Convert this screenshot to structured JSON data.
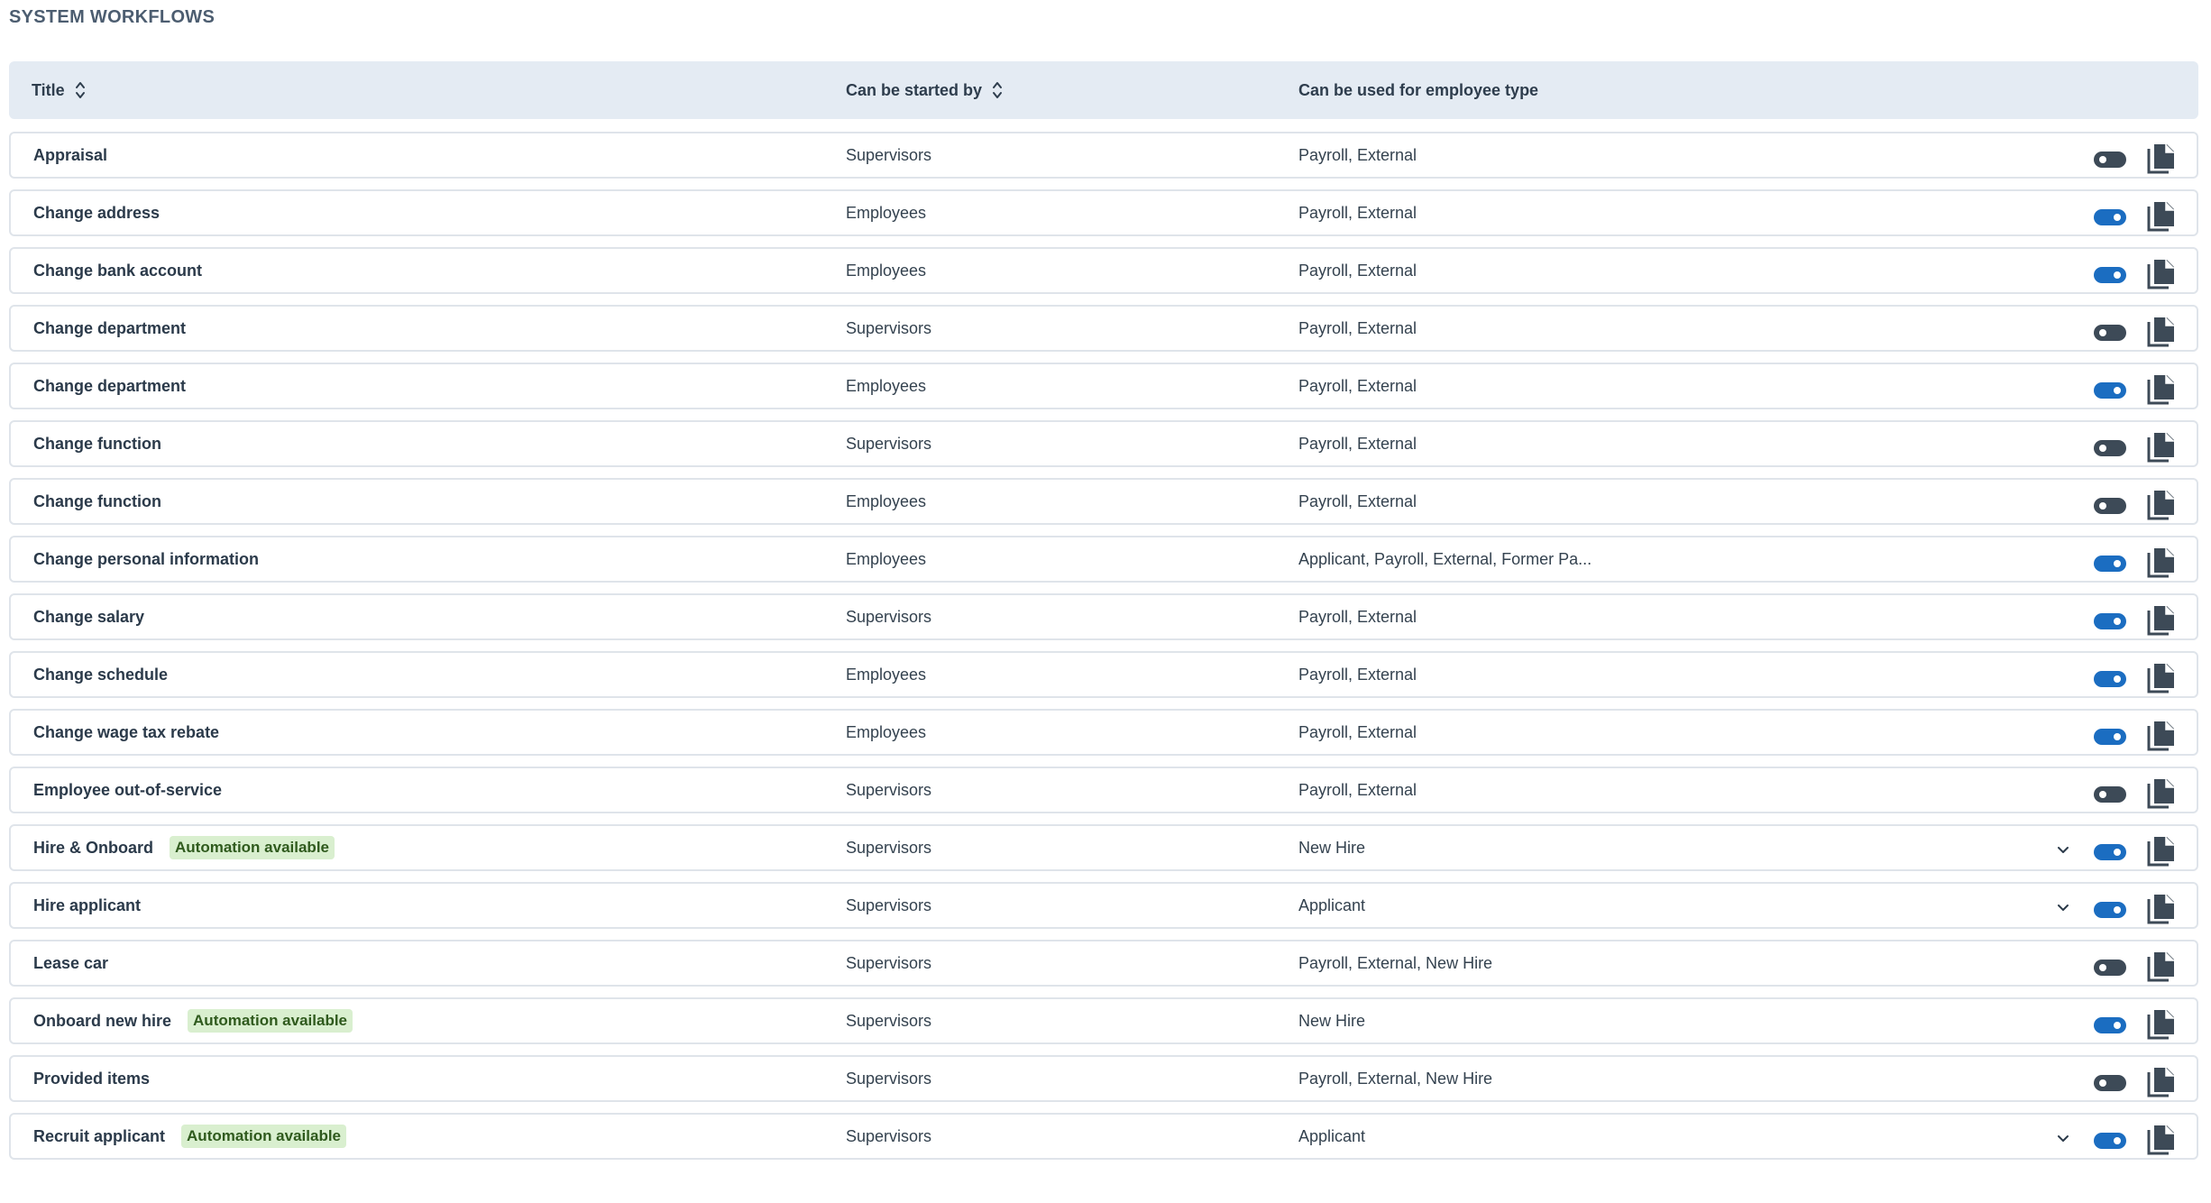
{
  "section": {
    "title": "SYSTEM WORKFLOWS"
  },
  "columns": {
    "title": "Title",
    "started_by": "Can be started by",
    "employee_type": "Can be used for employee type"
  },
  "badge_label": "Automation available",
  "colors": {
    "toggle_on": "#1b6dc1",
    "toggle_off": "#3d4a57",
    "badge_bg": "#d9efcf",
    "header_bg": "#e4ebf3"
  },
  "icons": {
    "sort": "sort-icon",
    "toggle": "toggle-icon",
    "copy": "copy-icon",
    "expand": "chevron-down-icon"
  },
  "rows": [
    {
      "title": "Appraisal",
      "started_by": "Supervisors",
      "employee_type": "Payroll, External",
      "enabled": false,
      "automation": false,
      "expandable": false
    },
    {
      "title": "Change address",
      "started_by": "Employees",
      "employee_type": "Payroll, External",
      "enabled": true,
      "automation": false,
      "expandable": false
    },
    {
      "title": "Change bank account",
      "started_by": "Employees",
      "employee_type": "Payroll, External",
      "enabled": true,
      "automation": false,
      "expandable": false
    },
    {
      "title": "Change department",
      "started_by": "Supervisors",
      "employee_type": "Payroll, External",
      "enabled": false,
      "automation": false,
      "expandable": false
    },
    {
      "title": "Change department",
      "started_by": "Employees",
      "employee_type": "Payroll, External",
      "enabled": true,
      "automation": false,
      "expandable": false
    },
    {
      "title": "Change function",
      "started_by": "Supervisors",
      "employee_type": "Payroll, External",
      "enabled": false,
      "automation": false,
      "expandable": false
    },
    {
      "title": "Change function",
      "started_by": "Employees",
      "employee_type": "Payroll, External",
      "enabled": false,
      "automation": false,
      "expandable": false
    },
    {
      "title": "Change personal information",
      "started_by": "Employees",
      "employee_type": "Applicant, Payroll, External, Former Pa...",
      "enabled": true,
      "automation": false,
      "expandable": false
    },
    {
      "title": "Change salary",
      "started_by": "Supervisors",
      "employee_type": "Payroll, External",
      "enabled": true,
      "automation": false,
      "expandable": false
    },
    {
      "title": "Change schedule",
      "started_by": "Employees",
      "employee_type": "Payroll, External",
      "enabled": true,
      "automation": false,
      "expandable": false
    },
    {
      "title": "Change wage tax rebate",
      "started_by": "Employees",
      "employee_type": "Payroll, External",
      "enabled": true,
      "automation": false,
      "expandable": false
    },
    {
      "title": "Employee out-of-service",
      "started_by": "Supervisors",
      "employee_type": "Payroll, External",
      "enabled": false,
      "automation": false,
      "expandable": false
    },
    {
      "title": "Hire & Onboard",
      "started_by": "Supervisors",
      "employee_type": "New Hire",
      "enabled": true,
      "automation": true,
      "expandable": true
    },
    {
      "title": "Hire applicant",
      "started_by": "Supervisors",
      "employee_type": "Applicant",
      "enabled": true,
      "automation": false,
      "expandable": true
    },
    {
      "title": "Lease car",
      "started_by": "Supervisors",
      "employee_type": "Payroll, External, New Hire",
      "enabled": false,
      "automation": false,
      "expandable": false
    },
    {
      "title": "Onboard new hire",
      "started_by": "Supervisors",
      "employee_type": "New Hire",
      "enabled": true,
      "automation": true,
      "expandable": false
    },
    {
      "title": "Provided items",
      "started_by": "Supervisors",
      "employee_type": "Payroll, External, New Hire",
      "enabled": false,
      "automation": false,
      "expandable": false
    },
    {
      "title": "Recruit applicant",
      "started_by": "Supervisors",
      "employee_type": "Applicant",
      "enabled": true,
      "automation": true,
      "expandable": true
    }
  ]
}
